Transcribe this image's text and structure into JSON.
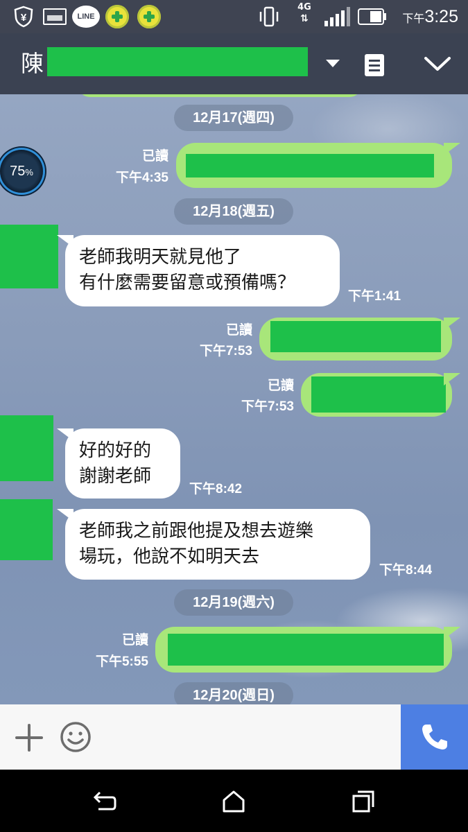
{
  "status_bar": {
    "clock_prefix": "下午",
    "clock_time": "3:25",
    "network": "4G",
    "line_label": "LINE"
  },
  "header": {
    "title_visible": "陳"
  },
  "badge": {
    "percent_value": "75",
    "percent_sign": "%"
  },
  "messages": [
    {
      "type": "date",
      "text": "12月17(週四)"
    },
    {
      "type": "outgoing",
      "read": "已讀",
      "time": "下午4:35"
    },
    {
      "type": "date",
      "text": "12月18(週五)"
    },
    {
      "type": "incoming",
      "text": "老師我明天就見他了\n有什麼需要留意或預備嗎？",
      "time": "下午1:41"
    },
    {
      "type": "outgoing",
      "read": "已讀",
      "time": "下午7:53"
    },
    {
      "type": "outgoing",
      "read": "已讀",
      "time": "下午7:53"
    },
    {
      "type": "incoming",
      "text": "好的好的\n謝謝老師",
      "time": "下午8:42"
    },
    {
      "type": "incoming",
      "text": "老師我之前跟他提及想去遊樂\n場玩，他說不如明天去",
      "time": "下午8:44"
    },
    {
      "type": "date",
      "text": "12月19(週六)"
    },
    {
      "type": "outgoing",
      "read": "已讀",
      "time": "下午5:55"
    },
    {
      "type": "date",
      "text": "12月20(週日)"
    }
  ],
  "colors": {
    "header_bg": "#3b4252",
    "outgoing_bubble": "#a8e67a",
    "redaction": "#1ec04a",
    "call_button": "#4d7fe3"
  }
}
